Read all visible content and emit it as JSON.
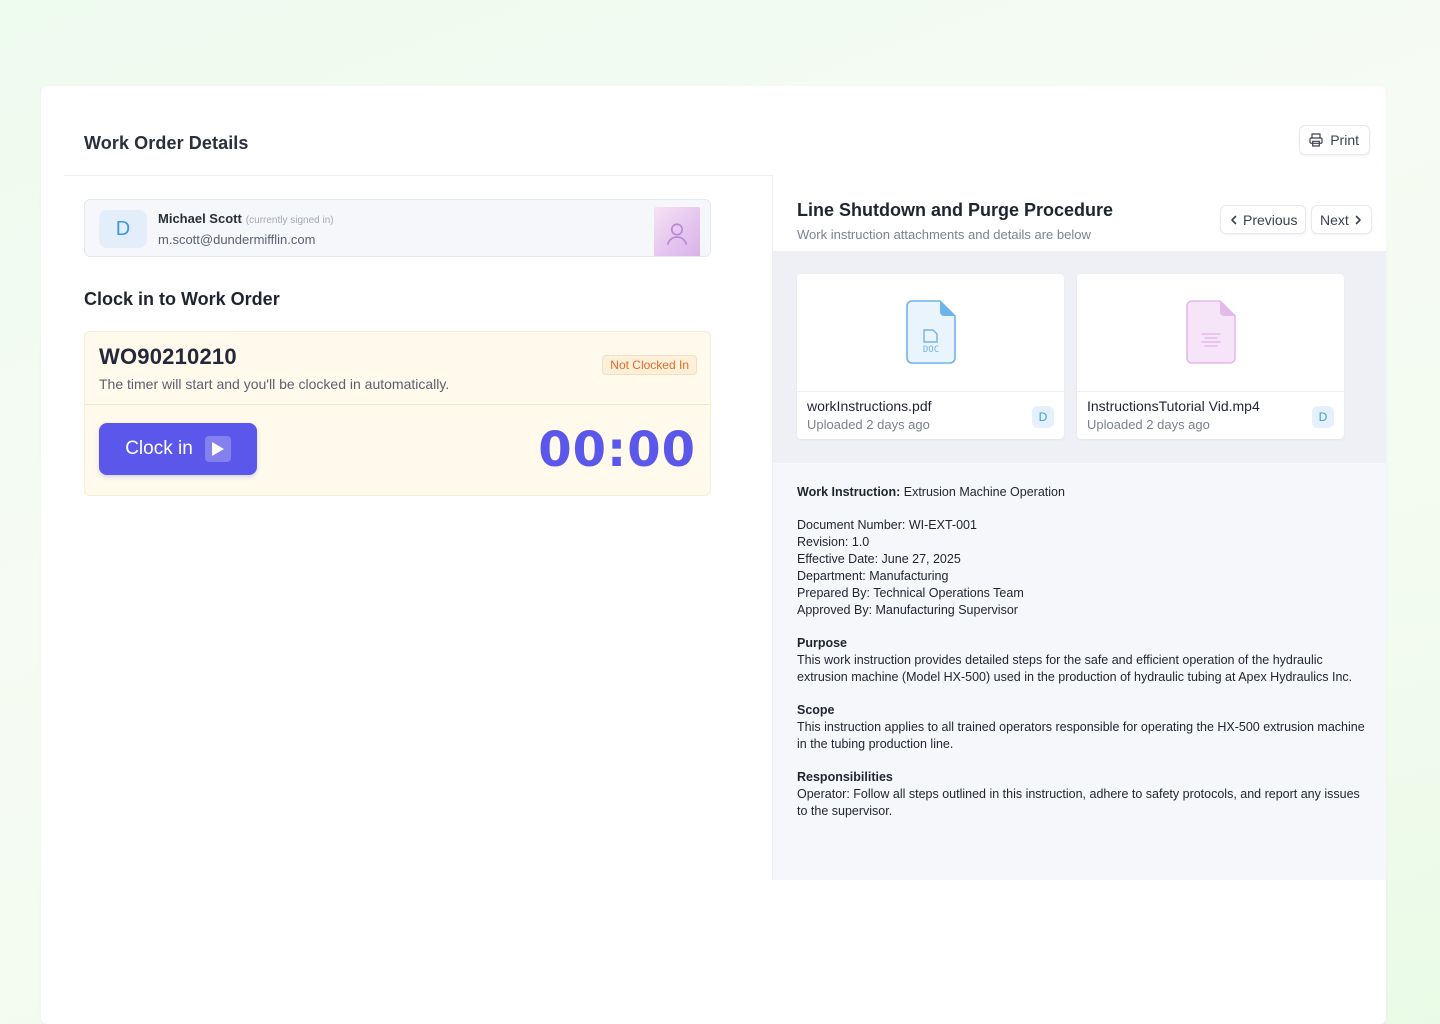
{
  "header": {
    "title": "Work Order Details",
    "print_label": "Print"
  },
  "user": {
    "initial": "D",
    "name": "Michael Scott",
    "status": "(currently signed in)",
    "email": "m.scott@dundermifflin.com"
  },
  "clock_section": {
    "title": "Clock in to Work Order",
    "work_order_id": "WO90210210",
    "subtitle": "The timer will start and you'll be clocked in automatically.",
    "badge": "Not Clocked In",
    "button_label": "Clock in",
    "timer": "00:00"
  },
  "instruction_panel": {
    "title": "Line Shutdown and Purge Procedure",
    "subtitle": "Work instruction attachments and details are below",
    "prev_label": "Previous",
    "next_label": "Next",
    "attachments": [
      {
        "name": "workInstructions.pdf",
        "uploaded": "Uploaded 2 days ago",
        "user_initial": "D",
        "icon": "doc-file-icon"
      },
      {
        "name": "InstructionsTutorial Vid.mp4",
        "uploaded": "Uploaded 2 days ago",
        "user_initial": "D",
        "icon": "video-file-icon"
      }
    ],
    "details": {
      "work_instruction_label": "Work Instruction:",
      "work_instruction_value": "Extrusion Machine Operation",
      "document_number": "Document Number: WI-EXT-001",
      "revision": "Revision: 1.0",
      "effective_date": "Effective Date: June 27, 2025",
      "department": "Department: Manufacturing",
      "prepared_by": "Prepared By: Technical Operations Team",
      "approved_by": "Approved By: Manufacturing Supervisor",
      "purpose_heading": "Purpose",
      "purpose_text": "This work instruction provides detailed steps for the safe and efficient operation of the hydraulic extrusion machine (Model HX-500) used in the production of hydraulic tubing at Apex Hydraulics Inc.",
      "scope_heading": "Scope",
      "scope_text": "This instruction applies to all trained operators responsible for operating the HX-500 extrusion machine in the tubing production line.",
      "responsibilities_heading": "Responsibilities",
      "responsibilities_text": "Operator: Follow all steps outlined in this instruction, adhere to safety protocols, and report any issues to the supervisor."
    }
  },
  "colors": {
    "accent": "#5b57ea",
    "badge_text": "#e06c2b",
    "avatar_blue": "#3e9ae0"
  }
}
